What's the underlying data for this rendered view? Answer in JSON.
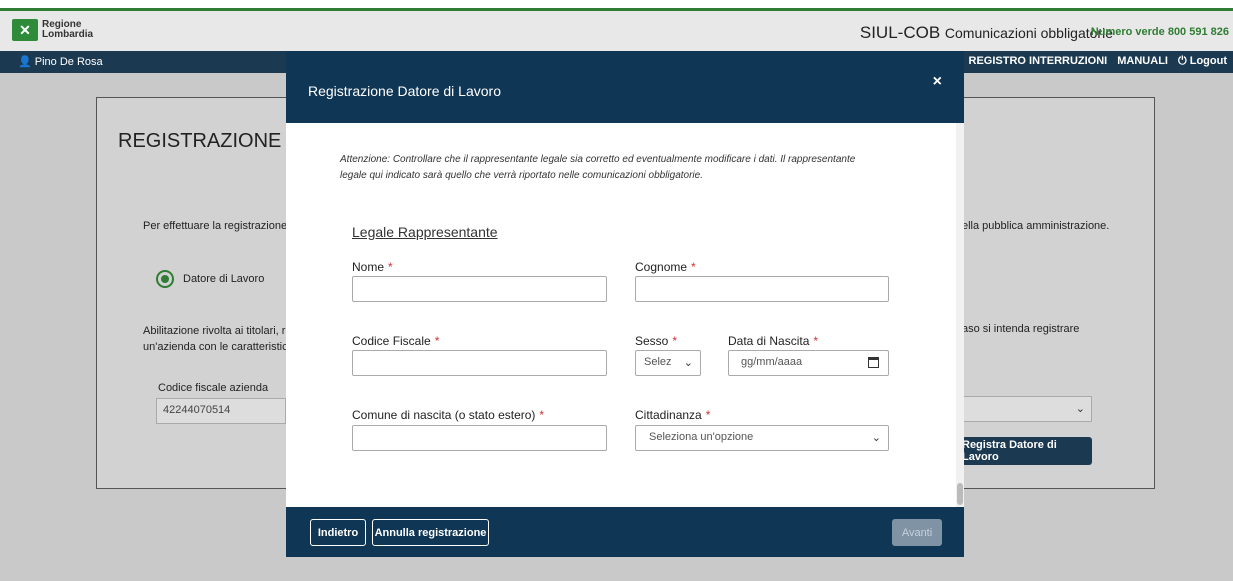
{
  "header": {
    "logo_text_line1": "Regione",
    "logo_text_line2": "Lombardia",
    "title_main": "SIUL-COB",
    "title_sub": "Comunicazioni obbligatorie",
    "phone": "Numero verde 800 591 826"
  },
  "navbar": {
    "user": "Pino De Rosa",
    "links": [
      "REGISTRO INTERRUZIONI",
      "MANUALI",
      "Logout"
    ]
  },
  "background": {
    "title": "REGISTRAZIONE UTENTE",
    "intro_left": "Per effettuare la registrazione d",
    "intro_right": "ella pubblica amministrazione.",
    "radio_label": "Datore di Lavoro",
    "abil_line1": "Abilitazione rivolta ai titolari, rap",
    "abil_line2": "un'azienda con le caratteristiche",
    "abil_right": "aso si intenda registrare",
    "cf_label": "Codice fiscale azienda",
    "cf_value": "42244070514",
    "register_button": "Registra Datore di Lavoro"
  },
  "modal": {
    "title": "Registrazione Datore di Lavoro",
    "close": "×",
    "notice": "Attenzione: Controllare che il rappresentante legale sia corretto ed eventualmente modificare i dati. Il rappresentante legale qui indicato sarà quello che verrà riportato nelle comunicazioni obbligatorie.",
    "section_title": "Legale Rappresentante",
    "required_mark": "*",
    "fields": {
      "nome": "Nome",
      "cognome": "Cognome",
      "codice_fiscale": "Codice Fiscale",
      "sesso": "Sesso",
      "sesso_value": "Selez",
      "data_nascita": "Data di Nascita",
      "data_placeholder": "gg/mm/aaaa",
      "comune": "Comune di nascita (o stato estero)",
      "cittadinanza": "Cittadinanza",
      "cittadinanza_value": "Seleziona un'opzione"
    },
    "footer": {
      "back": "Indietro",
      "cancel": "Annulla registrazione",
      "next": "Avanti"
    }
  }
}
